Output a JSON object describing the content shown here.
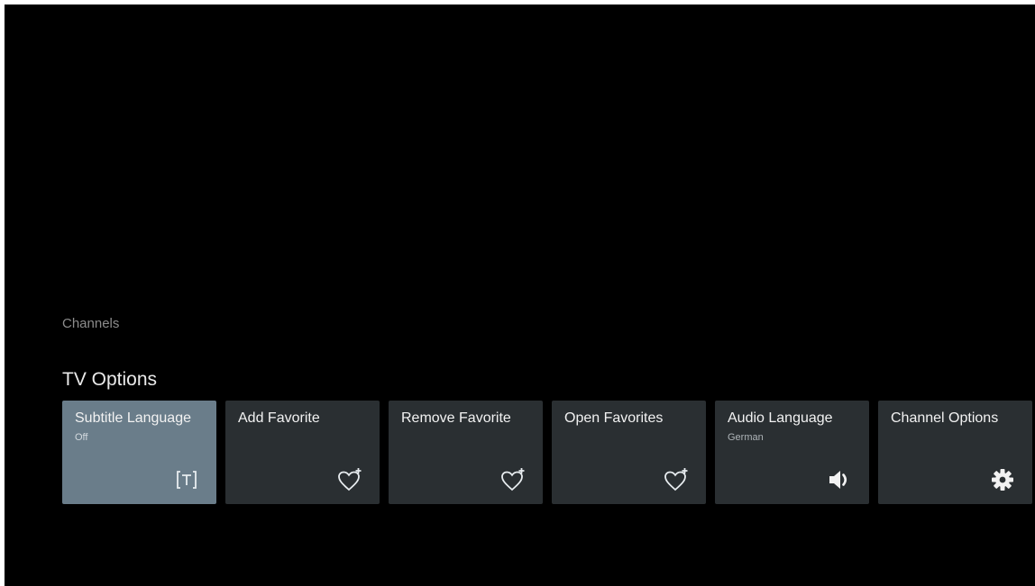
{
  "header": {
    "section_label": "Channels",
    "row_title": "TV Options"
  },
  "cards": [
    {
      "title": "Subtitle Language",
      "subtitle": "Off",
      "icon": "subtitle-text-icon",
      "focused": true
    },
    {
      "title": "Add Favorite",
      "subtitle": "",
      "icon": "heart-plus-icon",
      "focused": false
    },
    {
      "title": "Remove Favorite",
      "subtitle": "",
      "icon": "heart-plus-icon",
      "focused": false
    },
    {
      "title": "Open Favorites",
      "subtitle": "",
      "icon": "heart-plus-icon",
      "focused": false
    },
    {
      "title": "Audio Language",
      "subtitle": "German",
      "icon": "speaker-icon",
      "focused": false
    },
    {
      "title": "Channel Options",
      "subtitle": "",
      "icon": "gear-icon",
      "focused": false
    }
  ],
  "colors": {
    "background": "#000000",
    "card": "#2a2f32",
    "card_focused": "#6a7d8a"
  }
}
